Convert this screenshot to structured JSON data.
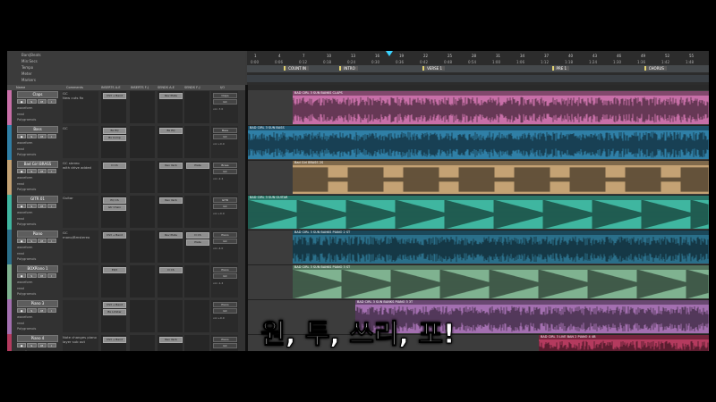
{
  "ruler_labels": [
    "Bars|Beats",
    "Min:Secs",
    "Markers",
    "Tempo"
  ],
  "ruler_rows_left": [
    "Bars|Beats",
    "Min:Secs",
    "Tempo",
    "Meter",
    "Markers"
  ],
  "bars": [
    "1",
    "4",
    "7",
    "10",
    "13",
    "16",
    "19",
    "22",
    "25",
    "28",
    "31",
    "34",
    "37",
    "40",
    "43",
    "46",
    "49",
    "52",
    "55"
  ],
  "mins": [
    "0:00",
    "0:06",
    "0:12",
    "0:18",
    "0:24",
    "0:30",
    "0:36",
    "0:42",
    "0:48",
    "0:54",
    "1:00",
    "1:06",
    "1:12",
    "1:18",
    "1:24",
    "1:30",
    "1:36",
    "1:42",
    "1:48"
  ],
  "markers": [
    {
      "label": "COUNT IN",
      "pos": 0.08
    },
    {
      "label": "INTRO",
      "pos": 0.2
    },
    {
      "label": "VERSE 1",
      "pos": 0.38
    },
    {
      "label": "PRE 1",
      "pos": 0.66
    },
    {
      "label": "CHORUS",
      "pos": 0.86
    }
  ],
  "header_cols": [
    "Name",
    "Comments",
    "INSERTS A-E",
    "INSERTS F-J",
    "SENDS A-E",
    "SENDS F-J",
    "I/O"
  ],
  "tracks": [
    {
      "name": "Claps",
      "color": "#c86fa8",
      "comment": "GC\nNew cuts fix",
      "inserts": [
        "CS3 + Bend"
      ],
      "sends": [
        "Rev Plate"
      ],
      "io": [
        "Claps",
        "GC"
      ],
      "vol": "vol -7.0",
      "clip": "BAD CIRL 3 SUN BANKS CLAPS"
    },
    {
      "name": "Bass",
      "color": "#2f7fa6",
      "comment": "GC",
      "inserts": [
        "Bx EQ",
        "Bx Comp"
      ],
      "sends": [
        "Bx EQ"
      ],
      "io": [
        "Bass",
        "GC"
      ],
      "vol": "vol +0.0",
      "clip": "BAD CIRL 3 SUN BASS"
    },
    {
      "name": "Bad Girl BRASS",
      "color": "#c4a274",
      "comment": "GC stereo\nwith drive added",
      "inserts": [
        "D CS"
      ],
      "sends": [
        "Rev Verb",
        "Plate"
      ],
      "io": [
        "Brass",
        "GC"
      ],
      "vol": "vol -2.4",
      "clip": "Bad Girl BRASS 2S"
    },
    {
      "name": "GITR 01",
      "color": "#3fb6a0",
      "comment": "Guitar",
      "inserts": [
        "EQ CS",
        "Gtr Chain"
      ],
      "sends": [
        "Rev Verb"
      ],
      "io": [
        "GITR",
        "GC"
      ],
      "vol": "vol +0.0",
      "clip": "BAD CIRL 3 SUN GUITAR"
    },
    {
      "name": "Piano",
      "color": "#2a6f8a",
      "comment": "GC\nmono/Bmstereo",
      "inserts": [
        "CS3 + Bend"
      ],
      "sends": [
        "Rev Plate",
        "D CS",
        "Plate"
      ],
      "io": [
        "Piano",
        "GC"
      ],
      "vol": "vol -4.0",
      "clip": "BAD CIRL 3 SUN BANKS PIANO 2 ST"
    },
    {
      "name": "BOXPiano 1",
      "color": "#7fb290",
      "comment": "",
      "inserts": [
        "EQ3"
      ],
      "sends": [
        "D CS"
      ],
      "io": [
        "Piano",
        "GC"
      ],
      "vol": "vol -1.4",
      "clip": "BAD CIRL 3 SUN BANKS PIANO 3 ST"
    },
    {
      "name": "Piano 3",
      "color": "#a36fb0",
      "comment": "",
      "inserts": [
        "CS3 + Bend",
        "Bx Limiter"
      ],
      "sends": [],
      "io": [
        "Piano",
        "GC"
      ],
      "vol": "vol +0.0",
      "clip": "BAD CIRL 3 SUN BANKS PIANO 3 3T"
    },
    {
      "name": "Piano 4",
      "color": "#b43a5e",
      "comment": "Note changes piano\nlayer sub out",
      "inserts": [
        "CS3 + Bend"
      ],
      "sends": [
        "Rev Verb"
      ],
      "io": [
        "Piano",
        "GC"
      ],
      "vol": "vol +0.0",
      "clip": "BAD CIRL 3 LIVE BAN 2 PIANO 4 4B"
    }
  ],
  "subtitle": "원, 투, 쓰리, 포!",
  "colors": {
    "bg": "#2a2a2a",
    "ruler": "#3a3a3a",
    "accent": "#3bd3ff"
  }
}
